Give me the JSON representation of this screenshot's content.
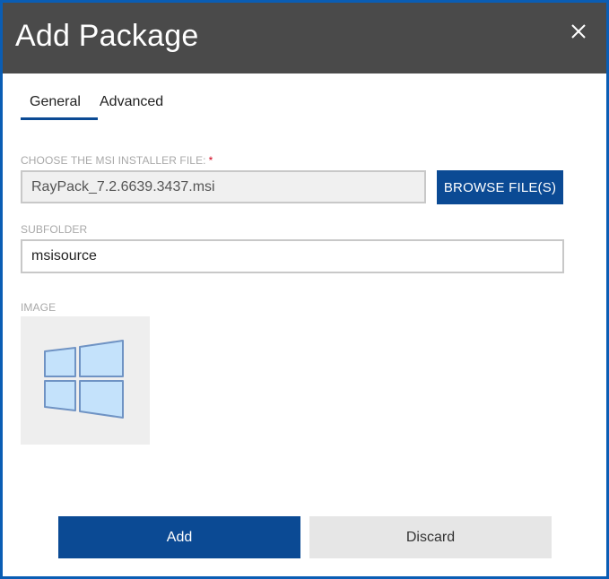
{
  "dialog": {
    "title": "Add Package",
    "close_icon": "close-icon"
  },
  "tabs": [
    {
      "label": "General",
      "active": true
    },
    {
      "label": "Advanced",
      "active": false
    }
  ],
  "fields": {
    "msi_file": {
      "label": "CHOOSE THE MSI INSTALLER FILE:",
      "required_marker": "*",
      "value": "RayPack_7.2.6639.3437.msi"
    },
    "browse_label": "BROWSE FILE(S)",
    "subfolder": {
      "label": "SUBFOLDER",
      "value": "msisource"
    },
    "image": {
      "label": "IMAGE",
      "icon": "windows-logo-icon"
    }
  },
  "footer": {
    "add_label": "Add",
    "discard_label": "Discard"
  },
  "colors": {
    "titlebar": "#4a4a4a",
    "accent": "#0b4a94",
    "frame": "#0a5db4",
    "required": "#d0021b"
  }
}
